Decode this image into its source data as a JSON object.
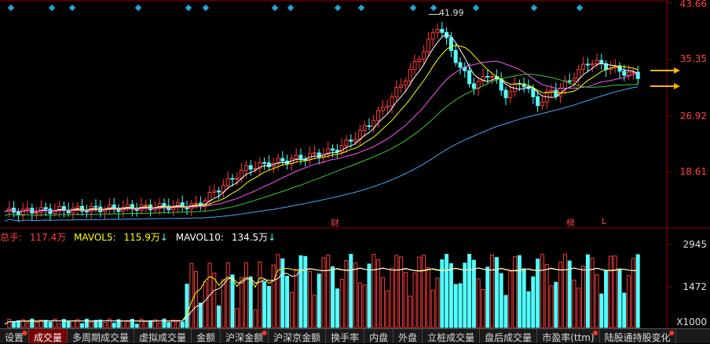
{
  "price_axis": {
    "labels": [
      "43.66",
      "35.35",
      "26.92",
      "18.61"
    ]
  },
  "peak_label": "41.99",
  "markers": {
    "cai": "财",
    "bang": "榜",
    "l": "L"
  },
  "volume_legend": {
    "total_label": "总手:",
    "total_value": "117.4万",
    "mavol5_label": "MAVOL5:",
    "mavol5_value": "115.9万",
    "mavol10_label": "MAVOL10:",
    "mavol10_value": "134.5万",
    "down_arrow": "↓"
  },
  "volume_axis": {
    "labels": [
      "2945",
      "1472"
    ],
    "unit": "X1000"
  },
  "tabs": [
    {
      "label": "设置",
      "star": true
    },
    {
      "label": "成交量",
      "active": true
    },
    {
      "label": "多周期成交量"
    },
    {
      "label": "虚拟成交量"
    },
    {
      "label": "金额"
    },
    {
      "label": "沪深金额",
      "star": true
    },
    {
      "label": "沪深京金额"
    },
    {
      "label": "换手率"
    },
    {
      "label": "内盘"
    },
    {
      "label": "外盘"
    },
    {
      "label": "立桩成交量"
    },
    {
      "label": "盘后成交量"
    },
    {
      "label": "市盈率(ttm)",
      "star": true
    },
    {
      "label": "陆股通持股变化",
      "star": true
    }
  ],
  "colors": {
    "up": "#ff3b3b",
    "down": "#54ffff",
    "ma5": "#ffffff",
    "ma10": "#ffff00",
    "ma20": "#ff55ff",
    "ma30": "#33cc33",
    "ma60": "#3fa9ff",
    "arrow": "#ffb400"
  }
}
